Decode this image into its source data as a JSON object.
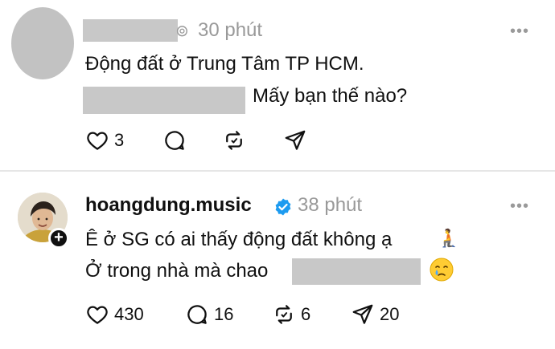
{
  "post1": {
    "time": "30 phút",
    "line1": "Động đất ở Trung Tâm TP HCM.",
    "line2": "Mấy bạn thế nào?",
    "likes": "3"
  },
  "post2": {
    "username": "hoangdung.music",
    "time": "38 phút",
    "line1": "Ê ở SG có ai thấy động đất không ạ",
    "line2": "Ở trong nhà mà chao",
    "likes": "430",
    "comments": "16",
    "reposts": "6",
    "shares": "20"
  },
  "icons": {
    "more": "more-icon",
    "like": "heart-icon",
    "comment": "comment-icon",
    "repost": "repost-icon",
    "share": "share-icon"
  },
  "colors": {
    "verified": "#1d9bf0",
    "muted": "#999999",
    "redacted": "#c8c8c8"
  }
}
